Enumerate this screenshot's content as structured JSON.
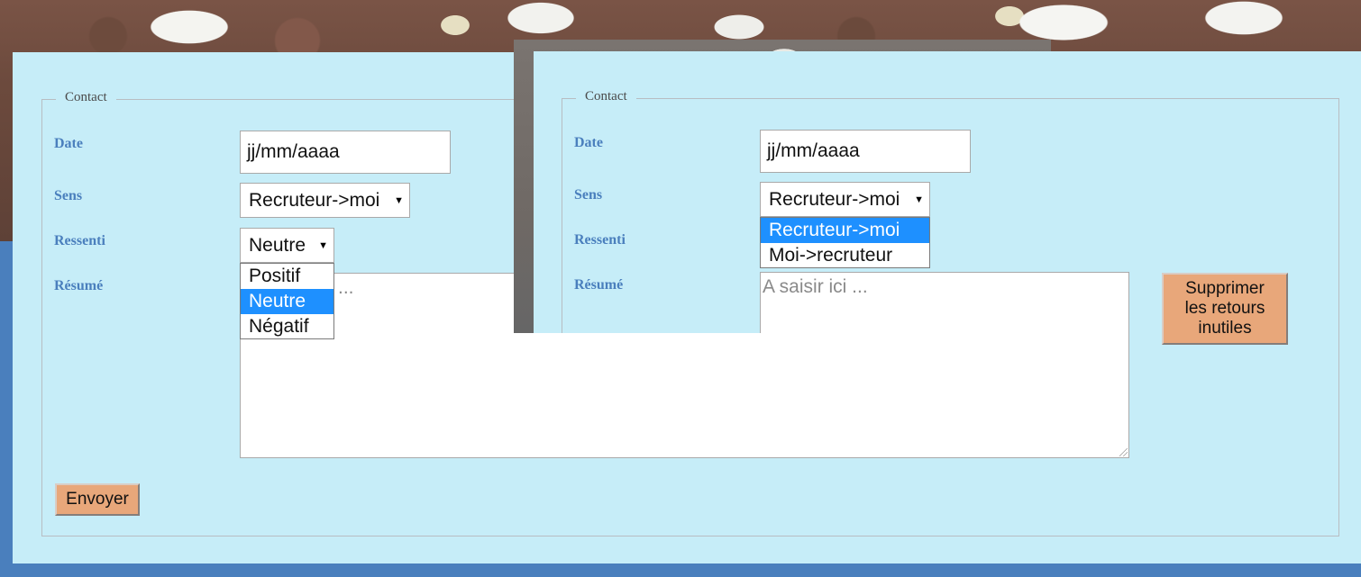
{
  "form_left": {
    "legend": "Contact",
    "labels": {
      "date": "Date",
      "sens": "Sens",
      "ressenti": "Ressenti",
      "resume": "Résumé"
    },
    "date_value": "jj/mm/aaaa",
    "sens_value": "Recruteur->moi",
    "ressenti_value": "Neutre",
    "ressenti_options": [
      "Positif",
      "Neutre",
      "Négatif"
    ],
    "resume_placeholder_visible": "...",
    "submit_label": "Envoyer"
  },
  "form_right": {
    "legend": "Contact",
    "labels": {
      "date": "Date",
      "sens": "Sens",
      "ressenti": "Ressenti",
      "resume": "Résumé"
    },
    "date_value": "jj/mm/aaaa",
    "sens_value": "Recruteur->moi",
    "sens_options": [
      "Recruteur->moi",
      "Moi->recruteur"
    ],
    "resume_placeholder": "A saisir ici ...",
    "delete_button_label": "Supprimer les retours inutiles"
  },
  "colors": {
    "panel": "#c6edf8",
    "page_background": "#4a7fbd",
    "label": "#4a7fbd",
    "button": "#e8a77a",
    "selected_option": "#1e90ff"
  },
  "icons": {
    "select_arrow": "dropdown-arrow-icon"
  }
}
